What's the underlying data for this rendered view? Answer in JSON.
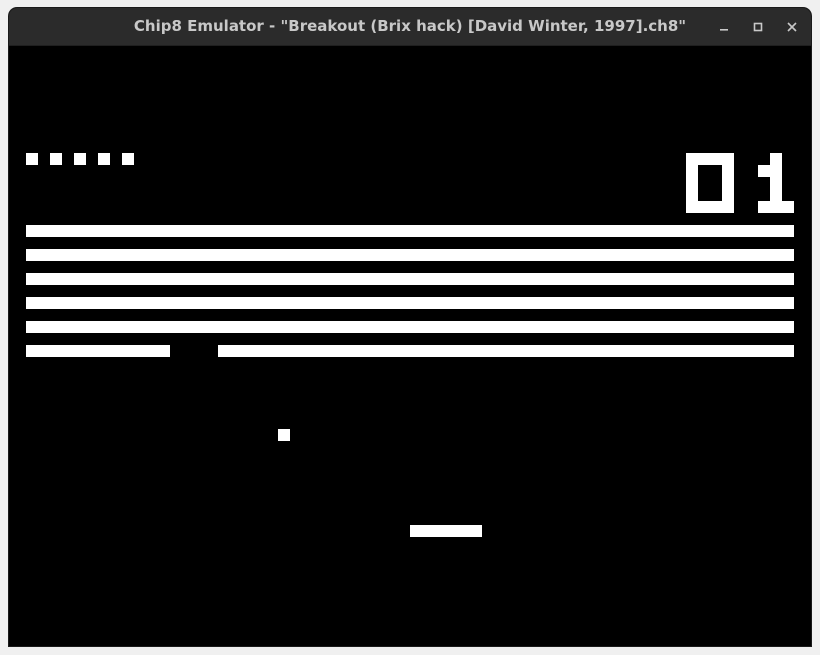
{
  "window": {
    "title": "Chip8 Emulator - \"Breakout (Brix hack) [David Winter, 1997].ch8\"",
    "controls": {
      "minimize_icon": "minimize-icon",
      "maximize_icon": "maximize-icon",
      "close_icon": "close-icon"
    }
  },
  "game": {
    "name": "Breakout (Brix hack)",
    "lives": 5,
    "score": "01",
    "brick_rows": 6,
    "colors": {
      "background": "#000000",
      "foreground": "#ffffff",
      "titlebar": "#2b2b2b",
      "title_text": "#c8c8c8"
    }
  }
}
